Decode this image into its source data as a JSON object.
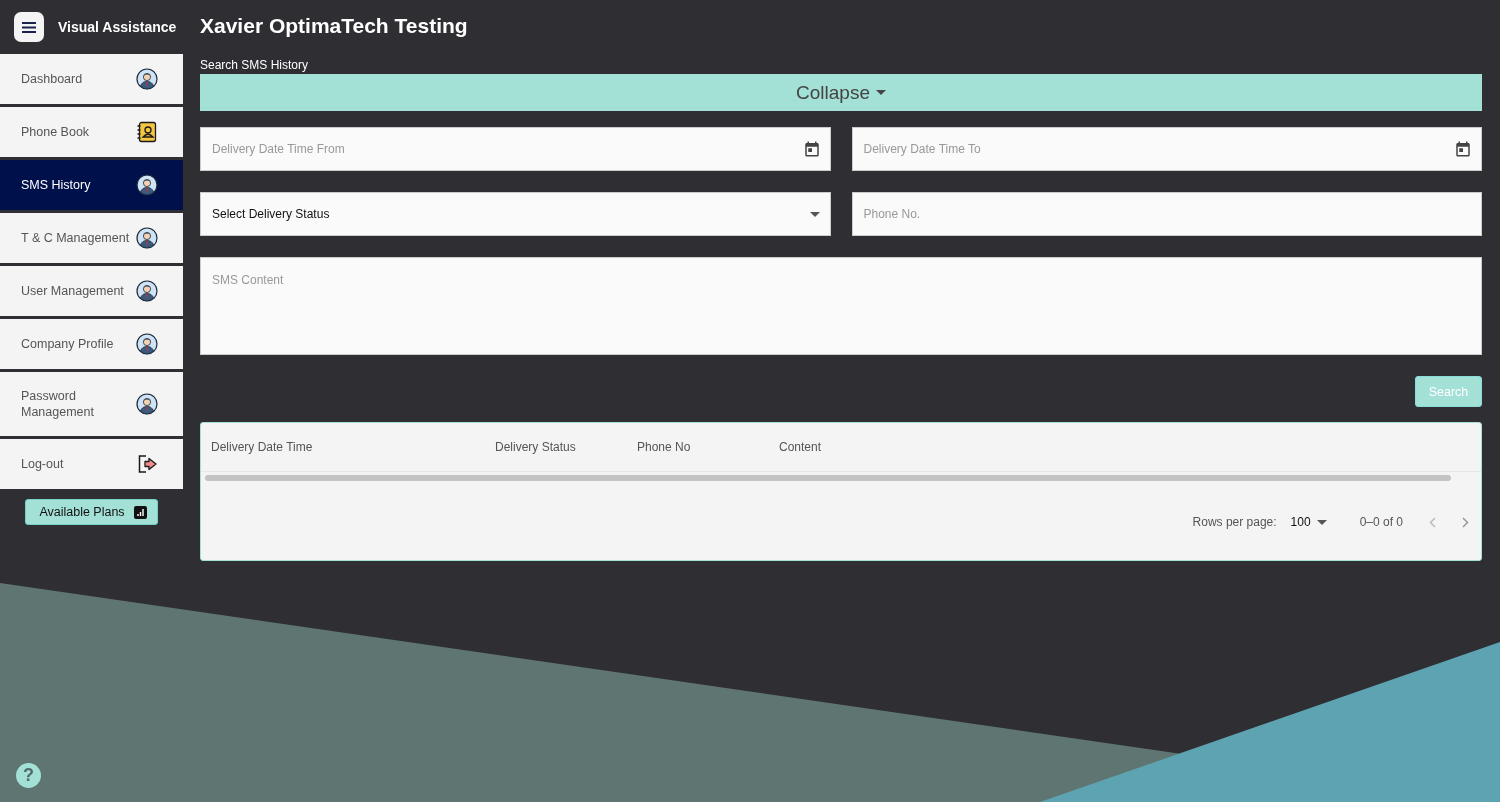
{
  "app": {
    "title": "Visual Assistance"
  },
  "page": {
    "title": "Xavier OptimaTech Testing"
  },
  "sidebar": {
    "items": [
      {
        "label": "Dashboard",
        "kind": "person",
        "selected": false
      },
      {
        "label": "Phone Book",
        "kind": "contacts",
        "selected": false
      },
      {
        "label": "SMS History",
        "kind": "person",
        "selected": true
      },
      {
        "label": "T & C Management",
        "kind": "person",
        "selected": false
      },
      {
        "label": "User Management",
        "kind": "person",
        "selected": false
      },
      {
        "label": "Company Profile",
        "kind": "person",
        "selected": false
      },
      {
        "label": "Password Management",
        "kind": "person",
        "selected": false
      },
      {
        "label": "Log-out",
        "kind": "logout",
        "selected": false
      }
    ],
    "plans_button": "Available Plans"
  },
  "search": {
    "heading": "Search SMS History",
    "collapse": "Collapse",
    "fields": [
      {
        "kind": "date",
        "placeholder": "Delivery Date Time From"
      },
      {
        "kind": "date",
        "placeholder": "Delivery Date Time To"
      },
      {
        "kind": "select",
        "value": "Select Delivery Status"
      },
      {
        "kind": "text",
        "placeholder": "Phone No."
      },
      {
        "kind": "textarea",
        "placeholder": "SMS Content"
      }
    ],
    "button": "Search"
  },
  "table": {
    "columns": [
      "Delivery Date Time",
      "Delivery Status",
      "Phone No",
      "Content"
    ],
    "rows_per_page_label": "Rows per page:",
    "rows_per_page": "100",
    "range": "0–0 of 0"
  },
  "help": "?"
}
